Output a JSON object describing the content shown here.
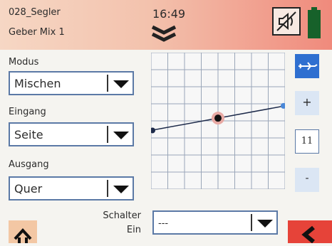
{
  "header": {
    "model_name": "028_Segler",
    "screen_title": "Geber Mix 1",
    "time": "16:49"
  },
  "fields": {
    "mode_label": "Modus",
    "mode_value": "Mischen",
    "input_label": "Eingang",
    "input_value": "Seite",
    "output_label": "Ausgang",
    "output_value": "Quer"
  },
  "side": {
    "plus": "+",
    "value": "11",
    "minus": "-"
  },
  "switch": {
    "label_line1": "Schalter",
    "label_line2": "Ein",
    "value": "---"
  },
  "curve": {
    "left_y": -0.14,
    "center_y": 0.04,
    "right_y": 0.22
  },
  "colors": {
    "accent_blue": "#2f6fd0",
    "header_red": "#f08a7c",
    "back_red": "#e64339",
    "battery_green": "#17612a"
  },
  "icons": {
    "nav": "double-chevron-down-icon",
    "mute": "speaker-muted-icon",
    "battery": "battery-icon",
    "plane": "airplane-icon",
    "home": "home-icon",
    "back": "back-chevron-icon"
  }
}
